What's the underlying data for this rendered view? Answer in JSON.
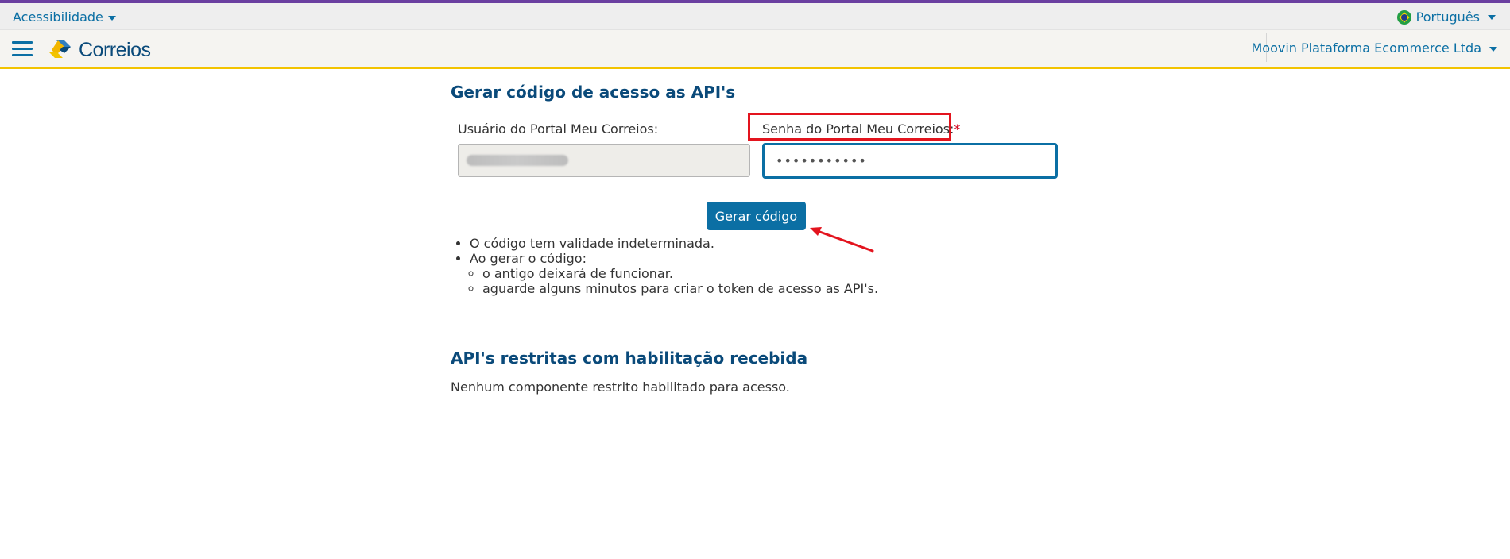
{
  "topbar": {
    "accessibility_label": "Acessibilidade",
    "language_label": "Português"
  },
  "header": {
    "logo_text": "Correios",
    "company_name": "Moovin Plataforma Ecommerce Ltda"
  },
  "form": {
    "title": "Gerar código de acesso as API's",
    "user_label": "Usuário do Portal Meu Correios:",
    "password_label": "Senha do Portal Meu Correios:",
    "required_marker": "*",
    "password_value": "•••••••••••",
    "generate_button": "Gerar código"
  },
  "info": {
    "item1": "O código tem validade indeterminada.",
    "item2": "Ao gerar o código:",
    "sub1": "o antigo deixará de funcionar.",
    "sub2": "aguarde alguns minutos para criar o token de acesso as API's."
  },
  "restricted": {
    "title": "API's restritas com habilitação recebida",
    "message": "Nenhum componente restrito habilitado para acesso."
  },
  "colors": {
    "brand_blue": "#0b6fa4",
    "title_blue": "#0a4a7a",
    "accent_yellow": "#f2c300",
    "annotation_red": "#e3141e"
  }
}
